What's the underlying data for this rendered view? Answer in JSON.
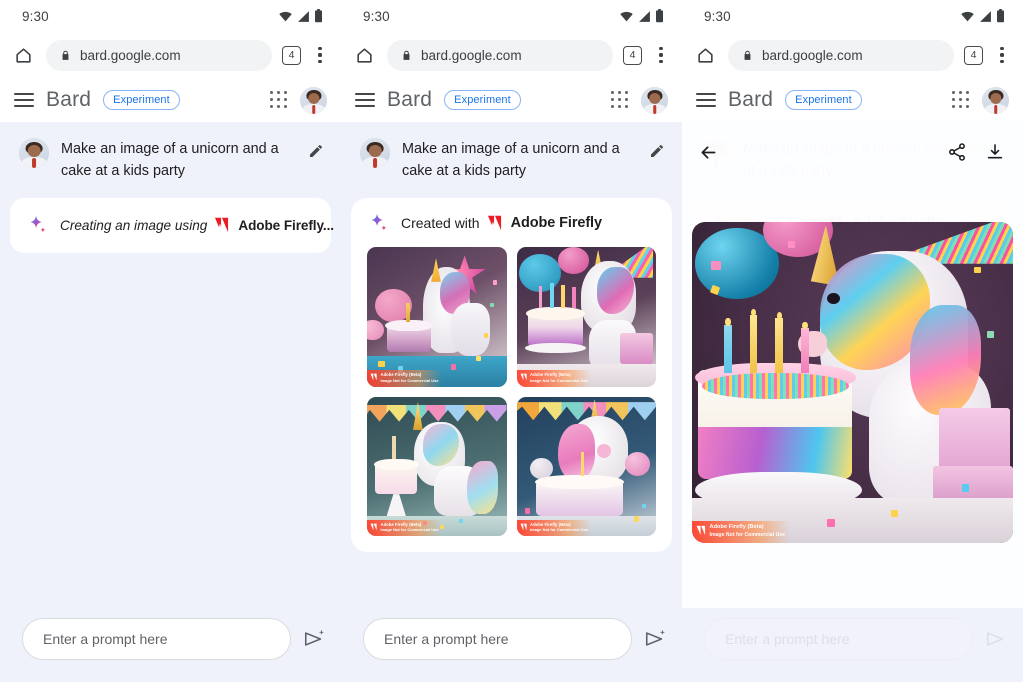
{
  "status": {
    "time": "9:30",
    "icons": [
      "wifi-icon",
      "signal-icon",
      "battery-icon"
    ]
  },
  "browser": {
    "home_icon": "home-icon",
    "lock_icon": "lock-icon",
    "url": "bard.google.com",
    "tab_count": "4",
    "menu_icon": "kebab-menu-icon"
  },
  "appbar": {
    "menu_icon": "hamburger-icon",
    "brand": "Bard",
    "badge": "Experiment",
    "apps_icon": "google-apps-grid-icon",
    "avatar": "user-avatar"
  },
  "conversation": {
    "user_prompt": "Make an image of a unicorn and a cake at a kids party",
    "edit_icon": "pencil-edit-icon",
    "loading_label": "Creating an image using",
    "done_label": "Created with",
    "provider": "Adobe Firefly",
    "loading_suffix": "...",
    "sparkle_icon": "bard-sparkle-icon",
    "firefly_icon": "adobe-firefly-logo"
  },
  "watermark": {
    "line1": "Adobe Firefly (Beta)",
    "line2": "Image Not for Commercial Use"
  },
  "composer": {
    "placeholder": "Enter a prompt here",
    "send_icon": "send-icon"
  },
  "detail_view": {
    "back_icon": "back-arrow-icon",
    "share_icon": "share-icon",
    "download_icon": "download-icon"
  },
  "colors": {
    "page_bg": "#eff1fb",
    "card_bg": "#ffffff",
    "accent_blue": "#1a73e8",
    "badge_border": "#8ab4f8",
    "text_primary": "#1f1f1f",
    "text_secondary": "#5f6368",
    "firefly_red": "#ec1c24"
  },
  "panels": [
    {
      "id": "panel-loading",
      "state": "generating"
    },
    {
      "id": "panel-results",
      "state": "four-results"
    },
    {
      "id": "panel-detail",
      "state": "single-image-detail"
    }
  ],
  "gallery": [
    {
      "name": "unicorn-cake-1",
      "alt": "White unicorn with rainbow mane beside a purple layer cake with candle, pink balloons, confetti"
    },
    {
      "name": "unicorn-cake-2",
      "alt": "Unicorn behind a rainbow drip cake with four candles, teal balloon, gift boxes"
    },
    {
      "name": "unicorn-cake-3",
      "alt": "Pastel unicorn next to tiered cake on stand with party bunting"
    },
    {
      "name": "unicorn-cake-4",
      "alt": "Pink-maned unicorn behind a sprinkled cake with bunting and balloons"
    }
  ],
  "hero_image": {
    "name": "unicorn-cake-hero",
    "alt": "Large white unicorn with rainbow mane beside a rainbow drip birthday cake with five candles, balloons, gifts and confetti"
  }
}
